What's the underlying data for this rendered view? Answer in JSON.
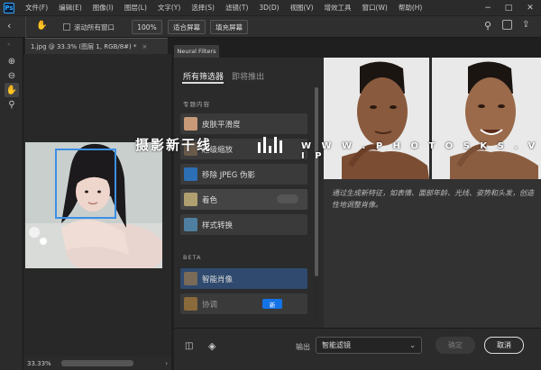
{
  "menubar": {
    "logo": "Ps",
    "items": [
      "文件(F)",
      "编辑(E)",
      "图像(I)",
      "图层(L)",
      "文字(Y)",
      "选择(S)",
      "滤镜(T)",
      "3D(D)",
      "视图(V)",
      "增效工具",
      "窗口(W)",
      "帮助(H)"
    ],
    "controls": [
      "−",
      "□",
      "✕"
    ]
  },
  "options": {
    "scroll_all": "滚动所有窗口",
    "zoom_100": "100%",
    "fit_screen": "适合屏幕",
    "fill_screen": "填充屏幕"
  },
  "document": {
    "tab": "1.jpg @ 33.3% (图层 1, RGB/8#) *",
    "zoom": "33.33%"
  },
  "neural": {
    "tab": "Neural Filters",
    "tab_all": "所有筛选器",
    "tab_coming": "即将推出",
    "section_featured": "专题内容",
    "filters": [
      {
        "label": "皮肤平滑度",
        "color": "#c89a78"
      },
      {
        "label": "超级缩放",
        "color": "#6a5a4a"
      },
      {
        "label": "移除 JPEG 伪影",
        "color": "#2c6fb5"
      },
      {
        "label": "着色",
        "color": "#b0a070"
      },
      {
        "label": "样式转换",
        "color": "#4f7fa0"
      }
    ],
    "section_beta": "BETA",
    "beta": [
      {
        "label": "智能肖像",
        "color": "#7a6a58"
      },
      {
        "label": "协调",
        "color": "#8a6a3a",
        "badge": "新"
      }
    ],
    "description": "通过生成新特征，如表情、面部年龄、光线、姿势和头发，创造性地调整肖像。",
    "output_label": "输出",
    "output_value": "智能滤镜",
    "ok": "确定",
    "cancel": "取消"
  },
  "watermark": {
    "text": "摄影新干线",
    "url": "W W W . P H O T O S K S . V I P"
  },
  "colors": {
    "accent": "#31a8ff",
    "active": "#2f4a6e"
  }
}
